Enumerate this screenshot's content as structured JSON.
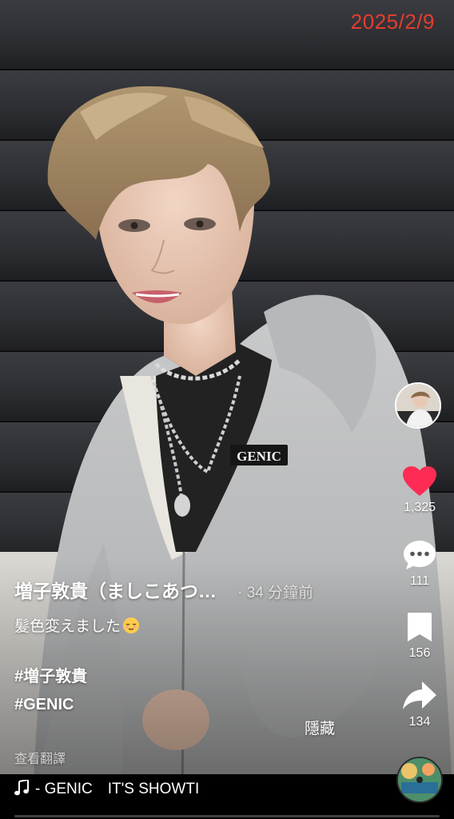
{
  "date_stamp": "2025/2/9",
  "author": {
    "name": "増子敦貴（ましこあつ…",
    "time_ago": "· 34 分鐘前"
  },
  "caption": {
    "text": "髪色変えました",
    "emoji": "relieved-face-emoji",
    "hashtags": [
      "#増子敦貴",
      "#GENIC"
    ]
  },
  "translate_label": "查看翻譯",
  "hide_label": "隱藏",
  "actions": {
    "likes": "1,325",
    "comments": "111",
    "bookmarks": "156",
    "shares": "134"
  },
  "music": {
    "title": "- GENIC　IT'S SHOWTI"
  },
  "sweatshirt_print": "GENIC",
  "colors": {
    "like_red": "#fe2c55",
    "date_stamp": "#e53d2f"
  }
}
